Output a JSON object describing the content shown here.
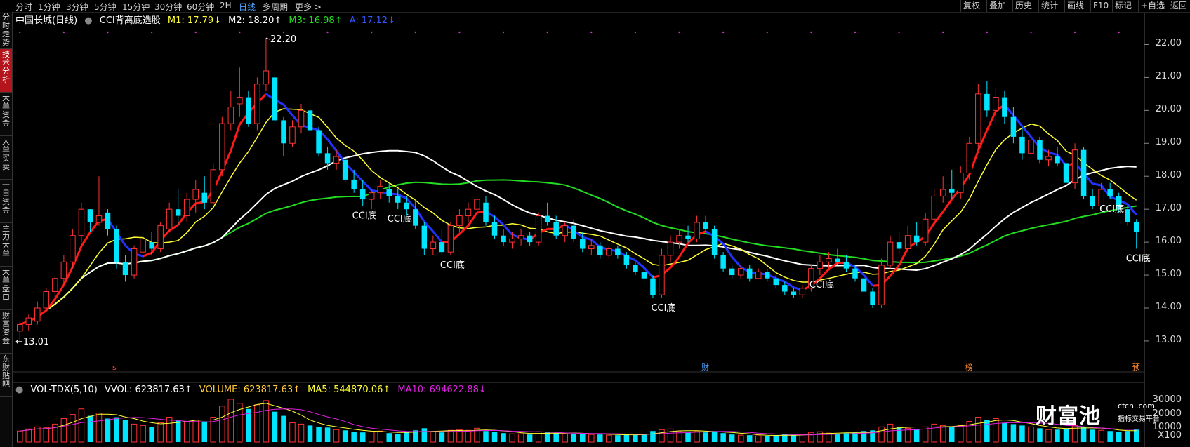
{
  "toolbar": {
    "left": [
      "分时",
      "1分钟",
      "3分钟",
      "5分钟",
      "15分钟",
      "30分钟",
      "60分钟",
      "2H",
      "日线",
      "多周期",
      "更多 >"
    ],
    "active_index": 8,
    "right": [
      "复权",
      "叠加",
      "历史",
      "统计",
      "画线",
      "F10",
      "标记",
      "+自选",
      "返回"
    ]
  },
  "sidebar": [
    {
      "label": "分时走势",
      "active": false
    },
    {
      "label": "技术分析",
      "active": true
    },
    {
      "label": "大单资金",
      "active": false
    },
    {
      "label": "大单买卖",
      "active": false
    },
    {
      "label": "一日资金",
      "active": false
    },
    {
      "label": "主力大单",
      "active": false
    },
    {
      "label": "大单盘口",
      "active": false
    },
    {
      "label": "财富资金",
      "active": false
    },
    {
      "label": "东财贴吧",
      "active": false
    }
  ],
  "chart_info": {
    "stock": "中国长城(日线)",
    "indicator": "CCI背离底选股",
    "m1": "M1: 17.79↓",
    "m2": "M2: 18.20↑",
    "m3": "M3: 16.98↑",
    "a": "A: 17.12↓"
  },
  "volume_info": {
    "title": "VOL-TDX(5,10)",
    "vvol": "VVOL: 623817.63↑",
    "volume": "VOLUME: 623817.63↑",
    "ma5": "MA5: 544870.06↑",
    "ma10": "MA10: 694622.88↓"
  },
  "colors": {
    "up": "#ff3333",
    "down": "#00e5ff",
    "m1": "#ffff33",
    "m2": "#ffffff",
    "m3": "#22dd22",
    "a": "#2233ff",
    "signal_red": "#ff1a1a",
    "ma5": "#ffff33",
    "ma10": "#dd22dd"
  },
  "price_axis": {
    "labels": [
      "22.00",
      "21.00",
      "20.00",
      "19.00",
      "18.00",
      "17.00",
      "16.00",
      "15.00",
      "14.00",
      "13.00"
    ],
    "values": [
      22,
      21,
      20,
      19,
      18,
      17,
      16,
      15,
      14,
      13
    ],
    "min": 12.7,
    "max": 22.5
  },
  "volume_axis": {
    "labels": [
      "30000",
      "20000",
      "10000",
      "X100"
    ],
    "values": [
      30000,
      20000,
      10000
    ],
    "max": 33000
  },
  "annotations": {
    "high": "22.20",
    "low": "13.01",
    "cci_label": "CCI底",
    "events": [
      "财",
      "榜",
      "预"
    ]
  },
  "chart_data": {
    "type": "candlestick",
    "title": "中国长城(日线)",
    "candles": [
      [
        13.3,
        13.6,
        13.0,
        13.5
      ],
      [
        13.5,
        13.8,
        13.3,
        13.7
      ],
      [
        13.6,
        14.2,
        13.5,
        14.0
      ],
      [
        14.0,
        14.6,
        13.9,
        14.5
      ],
      [
        14.5,
        15.0,
        14.3,
        14.9
      ],
      [
        14.9,
        15.6,
        14.7,
        15.4
      ],
      [
        15.4,
        16.4,
        15.2,
        16.2
      ],
      [
        16.2,
        17.2,
        16.0,
        17.0
      ],
      [
        17.0,
        17.0,
        16.3,
        16.6
      ],
      [
        16.6,
        18.0,
        16.5,
        16.8
      ],
      [
        16.9,
        17.0,
        16.2,
        16.4
      ],
      [
        16.4,
        16.5,
        15.2,
        15.4
      ],
      [
        15.4,
        15.6,
        14.8,
        15.0
      ],
      [
        15.0,
        15.9,
        14.9,
        15.8
      ],
      [
        15.7,
        16.3,
        15.5,
        16.1
      ],
      [
        16.0,
        16.3,
        15.6,
        15.8
      ],
      [
        15.8,
        16.6,
        15.7,
        16.5
      ],
      [
        16.4,
        17.2,
        16.3,
        17.0
      ],
      [
        17.0,
        17.6,
        16.5,
        16.8
      ],
      [
        16.8,
        17.5,
        16.6,
        17.3
      ],
      [
        17.3,
        17.9,
        16.9,
        17.6
      ],
      [
        17.5,
        18.0,
        17.0,
        17.2
      ],
      [
        17.2,
        18.4,
        17.1,
        18.2
      ],
      [
        18.2,
        19.8,
        18.0,
        19.6
      ],
      [
        19.6,
        20.6,
        19.4,
        20.1
      ],
      [
        20.2,
        21.3,
        19.8,
        20.4
      ],
      [
        20.4,
        20.6,
        19.5,
        19.6
      ],
      [
        19.6,
        21.0,
        19.4,
        20.8
      ],
      [
        20.8,
        22.2,
        20.6,
        21.2
      ],
      [
        21.0,
        21.1,
        19.6,
        19.7
      ],
      [
        19.7,
        19.8,
        18.6,
        19.0
      ],
      [
        19.0,
        19.7,
        18.9,
        19.5
      ],
      [
        19.5,
        20.2,
        19.3,
        20.0
      ],
      [
        20.0,
        20.3,
        19.3,
        19.4
      ],
      [
        19.4,
        19.5,
        18.6,
        18.7
      ],
      [
        18.7,
        18.9,
        18.2,
        18.4
      ],
      [
        18.4,
        18.8,
        18.2,
        18.6
      ],
      [
        18.5,
        18.6,
        17.8,
        17.9
      ],
      [
        17.9,
        18.2,
        17.5,
        17.6
      ],
      [
        17.6,
        17.9,
        17.1,
        17.3
      ],
      [
        17.3,
        17.6,
        17.0,
        17.5
      ],
      [
        17.5,
        17.9,
        17.3,
        17.7
      ],
      [
        17.6,
        17.8,
        17.2,
        17.4
      ],
      [
        17.4,
        17.6,
        17.0,
        17.2
      ],
      [
        17.2,
        17.4,
        16.8,
        17.0
      ],
      [
        17.0,
        17.3,
        16.4,
        16.5
      ],
      [
        16.5,
        16.6,
        15.6,
        15.8
      ],
      [
        15.8,
        16.2,
        15.6,
        16.0
      ],
      [
        16.0,
        16.4,
        15.6,
        15.7
      ],
      [
        15.7,
        16.6,
        15.6,
        16.5
      ],
      [
        16.5,
        17.0,
        16.3,
        16.8
      ],
      [
        16.8,
        17.2,
        16.6,
        17.0
      ],
      [
        17.0,
        17.6,
        16.8,
        17.3
      ],
      [
        17.2,
        17.4,
        16.5,
        16.6
      ],
      [
        16.6,
        16.8,
        16.1,
        16.2
      ],
      [
        16.2,
        16.4,
        15.9,
        16.0
      ],
      [
        16.0,
        16.3,
        15.8,
        16.1
      ],
      [
        16.1,
        16.4,
        15.9,
        16.2
      ],
      [
        16.2,
        16.3,
        15.9,
        16.0
      ],
      [
        16.0,
        16.9,
        15.9,
        16.8
      ],
      [
        16.8,
        17.2,
        16.5,
        16.6
      ],
      [
        16.6,
        16.8,
        16.1,
        16.2
      ],
      [
        16.2,
        16.6,
        16.0,
        16.5
      ],
      [
        16.5,
        16.7,
        16.0,
        16.1
      ],
      [
        16.1,
        16.3,
        15.7,
        15.8
      ],
      [
        15.8,
        16.1,
        15.6,
        15.9
      ],
      [
        15.9,
        16.0,
        15.5,
        15.6
      ],
      [
        15.6,
        15.9,
        15.5,
        15.8
      ],
      [
        15.8,
        15.9,
        15.5,
        15.6
      ],
      [
        15.6,
        15.7,
        15.2,
        15.3
      ],
      [
        15.3,
        15.4,
        15.0,
        15.1
      ],
      [
        15.1,
        15.4,
        14.8,
        14.9
      ],
      [
        14.9,
        15.0,
        14.3,
        14.4
      ],
      [
        14.4,
        15.8,
        14.3,
        15.6
      ],
      [
        15.6,
        16.2,
        15.4,
        16.0
      ],
      [
        16.0,
        16.4,
        15.8,
        16.2
      ],
      [
        16.2,
        16.5,
        16.0,
        16.1
      ],
      [
        16.1,
        16.8,
        16.0,
        16.6
      ],
      [
        16.6,
        16.8,
        16.3,
        16.4
      ],
      [
        16.4,
        16.5,
        15.5,
        15.6
      ],
      [
        15.6,
        15.7,
        15.1,
        15.2
      ],
      [
        15.2,
        15.3,
        14.9,
        15.0
      ],
      [
        15.0,
        15.3,
        14.9,
        15.2
      ],
      [
        15.2,
        15.3,
        14.8,
        14.9
      ],
      [
        14.9,
        15.2,
        14.9,
        15.1
      ],
      [
        15.1,
        15.2,
        14.8,
        14.9
      ],
      [
        14.9,
        15.0,
        14.6,
        14.7
      ],
      [
        14.7,
        14.8,
        14.4,
        14.5
      ],
      [
        14.5,
        14.6,
        14.3,
        14.4
      ],
      [
        14.4,
        14.7,
        14.3,
        14.6
      ],
      [
        14.6,
        15.3,
        14.5,
        15.2
      ],
      [
        15.2,
        15.6,
        15.0,
        15.4
      ],
      [
        15.4,
        15.7,
        15.2,
        15.5
      ],
      [
        15.5,
        15.8,
        15.3,
        15.4
      ],
      [
        15.4,
        15.6,
        15.1,
        15.2
      ],
      [
        15.2,
        15.3,
        14.8,
        14.9
      ],
      [
        14.9,
        15.0,
        14.4,
        14.5
      ],
      [
        14.5,
        14.6,
        14.0,
        14.1
      ],
      [
        14.1,
        15.5,
        14.0,
        15.3
      ],
      [
        15.3,
        16.2,
        15.2,
        16.0
      ],
      [
        16.0,
        16.3,
        15.6,
        15.8
      ],
      [
        15.8,
        16.5,
        15.7,
        16.2
      ],
      [
        16.2,
        16.6,
        15.9,
        16.0
      ],
      [
        16.0,
        16.9,
        15.9,
        16.7
      ],
      [
        16.7,
        17.6,
        16.5,
        17.4
      ],
      [
        17.4,
        18.0,
        17.2,
        17.6
      ],
      [
        17.6,
        18.2,
        17.3,
        17.5
      ],
      [
        17.5,
        18.3,
        17.3,
        18.1
      ],
      [
        18.1,
        19.2,
        17.9,
        19.0
      ],
      [
        19.0,
        20.8,
        18.8,
        20.5
      ],
      [
        20.5,
        20.9,
        19.8,
        20.0
      ],
      [
        20.0,
        20.7,
        19.6,
        20.4
      ],
      [
        20.4,
        20.6,
        19.6,
        19.8
      ],
      [
        19.8,
        20.1,
        19.0,
        19.2
      ],
      [
        19.2,
        19.5,
        18.5,
        18.7
      ],
      [
        18.7,
        19.3,
        18.3,
        19.1
      ],
      [
        19.1,
        19.2,
        18.4,
        18.5
      ],
      [
        18.5,
        18.8,
        18.3,
        18.6
      ],
      [
        18.6,
        18.9,
        18.3,
        18.4
      ],
      [
        18.4,
        18.5,
        17.7,
        17.8
      ],
      [
        17.8,
        19.0,
        17.6,
        18.8
      ],
      [
        18.8,
        18.9,
        17.3,
        17.4
      ],
      [
        17.4,
        17.6,
        17.0,
        17.1
      ],
      [
        17.1,
        17.8,
        17.0,
        17.6
      ],
      [
        17.6,
        17.8,
        17.3,
        17.4
      ],
      [
        17.4,
        17.5,
        16.9,
        17.0
      ],
      [
        17.0,
        17.1,
        16.5,
        16.6
      ],
      [
        16.6,
        16.7,
        15.8,
        16.3
      ]
    ],
    "volumes": [
      [
        8000,
        1
      ],
      [
        9500,
        1
      ],
      [
        11000,
        1
      ],
      [
        10500,
        1
      ],
      [
        13000,
        1
      ],
      [
        17000,
        1
      ],
      [
        20000,
        1
      ],
      [
        24000,
        1
      ],
      [
        19000,
        0
      ],
      [
        21000,
        1
      ],
      [
        17000,
        0
      ],
      [
        18000,
        0
      ],
      [
        16000,
        0
      ],
      [
        13000,
        1
      ],
      [
        12000,
        1
      ],
      [
        11000,
        0
      ],
      [
        14000,
        1
      ],
      [
        18000,
        1
      ],
      [
        16000,
        0
      ],
      [
        15000,
        1
      ],
      [
        16000,
        1
      ],
      [
        15000,
        0
      ],
      [
        18000,
        1
      ],
      [
        26000,
        1
      ],
      [
        31000,
        1
      ],
      [
        28000,
        1
      ],
      [
        24000,
        0
      ],
      [
        27000,
        1
      ],
      [
        30000,
        1
      ],
      [
        22000,
        0
      ],
      [
        19000,
        0
      ],
      [
        14000,
        1
      ],
      [
        13000,
        1
      ],
      [
        12000,
        0
      ],
      [
        11000,
        0
      ],
      [
        10500,
        0
      ],
      [
        9000,
        1
      ],
      [
        8500,
        0
      ],
      [
        7500,
        0
      ],
      [
        7000,
        0
      ],
      [
        7500,
        1
      ],
      [
        8000,
        1
      ],
      [
        6500,
        0
      ],
      [
        6000,
        0
      ],
      [
        7000,
        0
      ],
      [
        8500,
        0
      ],
      [
        10000,
        0
      ],
      [
        7500,
        1
      ],
      [
        7000,
        0
      ],
      [
        8500,
        1
      ],
      [
        9000,
        1
      ],
      [
        8500,
        1
      ],
      [
        10000,
        1
      ],
      [
        8000,
        0
      ],
      [
        7500,
        0
      ],
      [
        6500,
        0
      ],
      [
        6000,
        1
      ],
      [
        6000,
        1
      ],
      [
        5500,
        0
      ],
      [
        7500,
        1
      ],
      [
        7000,
        0
      ],
      [
        6500,
        0
      ],
      [
        6000,
        1
      ],
      [
        6000,
        0
      ],
      [
        6500,
        0
      ],
      [
        5500,
        1
      ],
      [
        5500,
        0
      ],
      [
        5000,
        1
      ],
      [
        5000,
        0
      ],
      [
        5500,
        0
      ],
      [
        5500,
        0
      ],
      [
        6000,
        0
      ],
      [
        8000,
        0
      ],
      [
        9000,
        1
      ],
      [
        9500,
        1
      ],
      [
        8000,
        1
      ],
      [
        7000,
        0
      ],
      [
        8000,
        1
      ],
      [
        7000,
        0
      ],
      [
        8000,
        0
      ],
      [
        6500,
        0
      ],
      [
        5500,
        0
      ],
      [
        5000,
        1
      ],
      [
        5000,
        0
      ],
      [
        4500,
        1
      ],
      [
        4500,
        0
      ],
      [
        5000,
        0
      ],
      [
        5500,
        0
      ],
      [
        5000,
        0
      ],
      [
        5500,
        1
      ],
      [
        7000,
        1
      ],
      [
        7500,
        1
      ],
      [
        6500,
        1
      ],
      [
        6000,
        0
      ],
      [
        6500,
        0
      ],
      [
        7000,
        0
      ],
      [
        8000,
        0
      ],
      [
        8500,
        0
      ],
      [
        11000,
        1
      ],
      [
        13000,
        1
      ],
      [
        11000,
        0
      ],
      [
        10000,
        1
      ],
      [
        9500,
        0
      ],
      [
        11000,
        1
      ],
      [
        13000,
        1
      ],
      [
        12000,
        1
      ],
      [
        11000,
        0
      ],
      [
        12000,
        1
      ],
      [
        15000,
        1
      ],
      [
        18000,
        1
      ],
      [
        16000,
        0
      ],
      [
        17000,
        1
      ],
      [
        14000,
        0
      ],
      [
        13000,
        0
      ],
      [
        12000,
        0
      ],
      [
        11000,
        1
      ],
      [
        10000,
        0
      ],
      [
        9000,
        1
      ],
      [
        9000,
        0
      ],
      [
        10000,
        0
      ],
      [
        12000,
        1
      ],
      [
        11000,
        0
      ],
      [
        9000,
        0
      ],
      [
        8500,
        1
      ],
      [
        8000,
        0
      ],
      [
        7500,
        0
      ],
      [
        8000,
        0
      ],
      [
        9000,
        0
      ]
    ],
    "series": [
      {
        "name": "M1",
        "values": []
      },
      {
        "name": "M2",
        "values": []
      },
      {
        "name": "M3",
        "values": []
      },
      {
        "name": "A",
        "values": []
      }
    ],
    "ylim": [
      12.7,
      22.5
    ]
  }
}
